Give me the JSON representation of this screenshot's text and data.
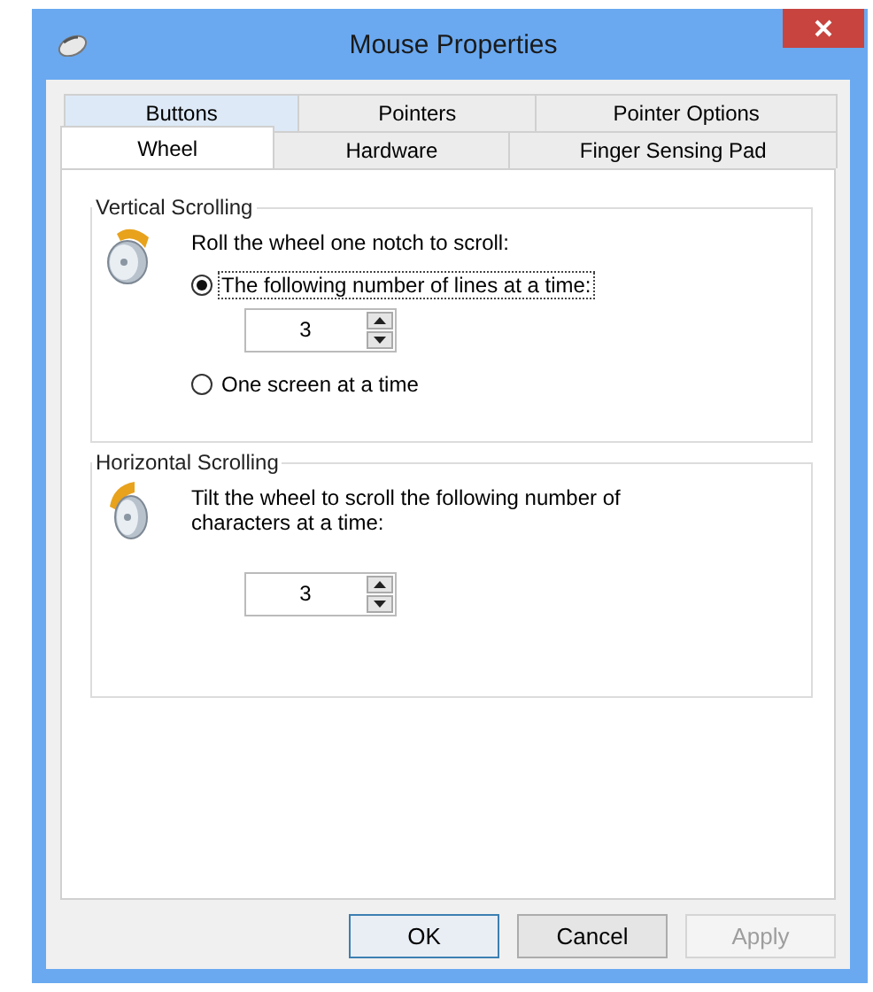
{
  "window": {
    "title": "Mouse Properties"
  },
  "tab_rows": [
    {
      "tabs": [
        {
          "label": "Buttons",
          "selected": false
        },
        {
          "label": "Pointers",
          "selected": false
        },
        {
          "label": "Pointer Options",
          "selected": false
        }
      ]
    },
    {
      "tabs": [
        {
          "label": "Wheel",
          "selected": true
        },
        {
          "label": "Hardware",
          "selected": false
        },
        {
          "label": "Finger Sensing Pad",
          "selected": false
        }
      ]
    }
  ],
  "vertical_scrolling": {
    "title": "Vertical Scrolling",
    "prompt": "Roll the wheel one notch to scroll:",
    "options": [
      {
        "label": "The following number of lines at a time:",
        "selected": true,
        "focused": true,
        "spinner": {
          "value": "3"
        }
      },
      {
        "label": "One screen at a time",
        "selected": false,
        "focused": false
      }
    ]
  },
  "horizontal_scrolling": {
    "title": "Horizontal Scrolling",
    "prompt": "Tilt the wheel to scroll the following number of characters at a time:",
    "spinner": {
      "value": "3"
    }
  },
  "buttons": [
    {
      "label": "OK",
      "disabled": false,
      "default": true
    },
    {
      "label": "Cancel",
      "disabled": false,
      "default": false
    },
    {
      "label": "Apply",
      "disabled": true,
      "default": false
    }
  ]
}
